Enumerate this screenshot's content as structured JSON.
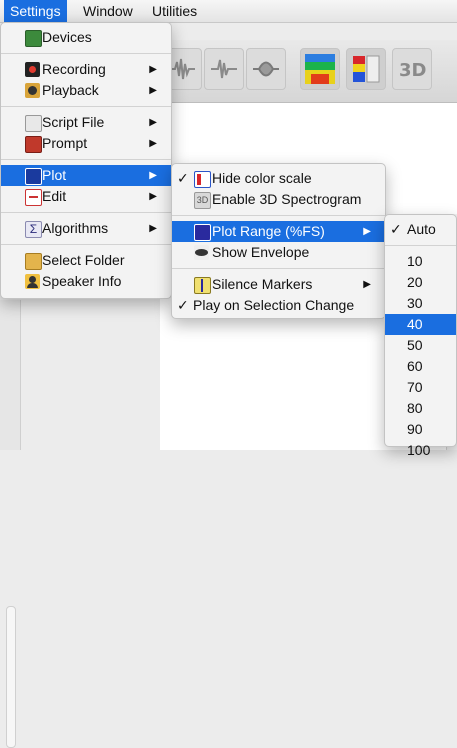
{
  "menubar": {
    "items": [
      {
        "label": "Settings",
        "active": true
      },
      {
        "label": "Window",
        "active": false
      },
      {
        "label": "Utilities",
        "active": false
      }
    ]
  },
  "settings_menu": {
    "items": [
      {
        "label": "Devices",
        "icon": "devices-icon"
      },
      {
        "label": "Recording",
        "icon": "recording-icon",
        "submenu": true
      },
      {
        "label": "Playback",
        "icon": "playback-icon",
        "submenu": true
      },
      {
        "label": "Script File",
        "icon": "script-file-icon",
        "submenu": true
      },
      {
        "label": "Prompt",
        "icon": "prompt-icon",
        "submenu": true
      },
      {
        "label": "Plot",
        "icon": "plot-icon",
        "submenu": true,
        "highlighted": true
      },
      {
        "label": "Edit",
        "icon": "edit-icon",
        "submenu": true
      },
      {
        "label": "Algorithms",
        "icon": "sigma-icon",
        "submenu": true
      },
      {
        "label": "Select Folder",
        "icon": "folder-search-icon"
      },
      {
        "label": "Speaker Info",
        "icon": "speaker-person-icon"
      }
    ]
  },
  "plot_menu": {
    "items": [
      {
        "label": "Hide color scale",
        "checked": true,
        "icon": "color-scale-icon"
      },
      {
        "label": "Enable 3D Spectrogram",
        "checked": false,
        "icon": "3d-spectrogram-icon"
      },
      {
        "label": "Plot Range (%FS)",
        "checked": false,
        "icon": "plot-range-icon",
        "submenu": true,
        "highlighted": true
      },
      {
        "label": "Show Envelope",
        "checked": false,
        "icon": "envelope-icon"
      },
      {
        "label": "Silence Markers",
        "checked": false,
        "icon": "silence-markers-icon",
        "submenu": true
      },
      {
        "label": "Play on Selection Change",
        "checked": true
      }
    ]
  },
  "range_menu": {
    "items": [
      {
        "label": "Auto",
        "checked": true
      },
      {
        "label": "10"
      },
      {
        "label": "20"
      },
      {
        "label": "30"
      },
      {
        "label": "40",
        "highlighted": true
      },
      {
        "label": "50"
      },
      {
        "label": "60"
      },
      {
        "label": "70"
      },
      {
        "label": "80"
      },
      {
        "label": "90"
      },
      {
        "label": "100"
      }
    ]
  },
  "check_mark": "✓",
  "submenu_arrow": "▶",
  "colors": {
    "highlight": "#1a6ee0",
    "menu_bg": "#f3f3f3"
  }
}
